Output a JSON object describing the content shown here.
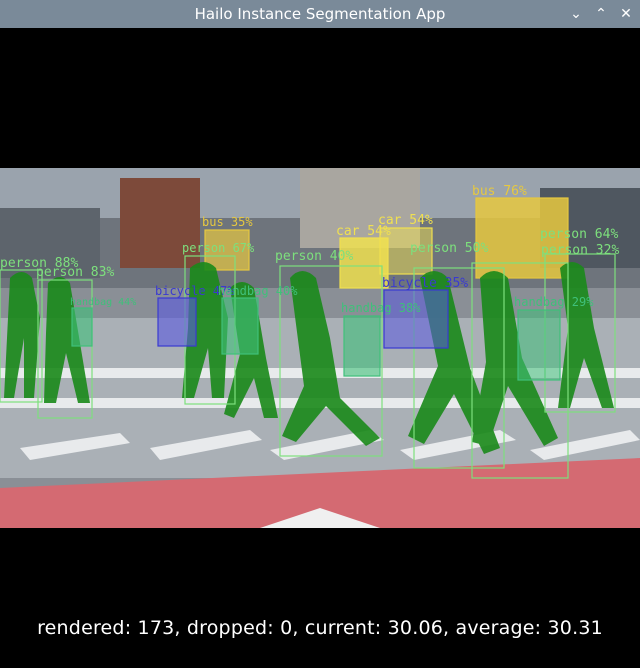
{
  "window": {
    "title": "Hailo Instance Segmentation App",
    "controls": {
      "minimize": "⌄",
      "maximize": "⌃",
      "close": "✕"
    }
  },
  "status_text": "rendered: 173, dropped: 0, current: 30.06, average: 30.31",
  "detections": [
    {
      "label": "bus 76%"
    },
    {
      "label": "bus 35%"
    },
    {
      "label": "car 54%"
    },
    {
      "label": "car 54%"
    },
    {
      "label": "person 88%"
    },
    {
      "label": "person 83%"
    },
    {
      "label": "person 67%"
    },
    {
      "label": "person 40%"
    },
    {
      "label": "person 50%"
    },
    {
      "label": "person 64%"
    },
    {
      "label": "person 32%"
    },
    {
      "label": "bicycle 47%"
    },
    {
      "label": "bicycle 35%"
    },
    {
      "label": "handbag 44%"
    },
    {
      "label": "handbag 40%"
    },
    {
      "label": "handbag 38%"
    },
    {
      "label": "handbag 29%"
    }
  ],
  "colors": {
    "person": "#1a8a1a",
    "person_box": "#7de07d",
    "bus": "#e6c840",
    "car": "#f0e050",
    "bicycle": "#3a3ad0",
    "handbag": "#3fc07a",
    "titlebar": "#7a8a99"
  }
}
